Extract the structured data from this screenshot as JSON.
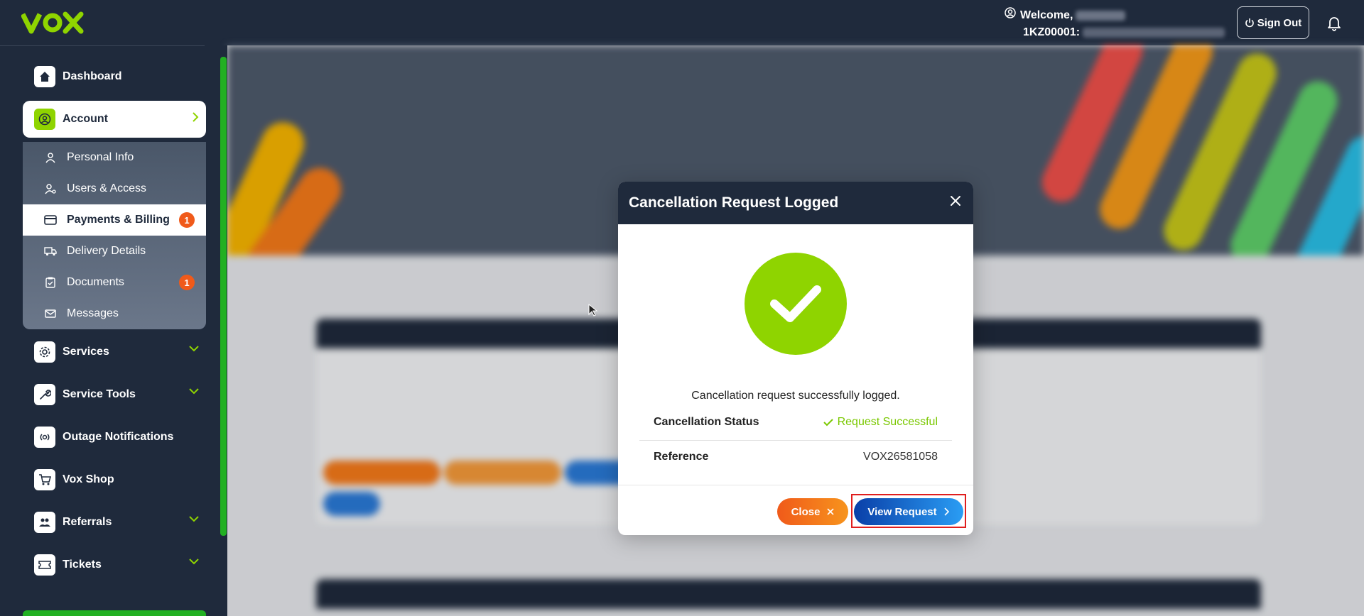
{
  "topbar": {
    "welcome_label": "Welcome,",
    "account_code": "1KZ00001:",
    "signout_label": "Sign Out"
  },
  "sidebar": {
    "items": [
      {
        "label": "Dashboard",
        "icon": "home-icon"
      },
      {
        "label": "Account",
        "icon": "user-circle-icon"
      },
      {
        "label": "Services",
        "icon": "gear-icon"
      },
      {
        "label": "Service Tools",
        "icon": "wrench-icon"
      },
      {
        "label": "Outage Notifications",
        "icon": "signal-icon"
      },
      {
        "label": "Vox Shop",
        "icon": "cart-icon"
      },
      {
        "label": "Referrals",
        "icon": "users-icon"
      },
      {
        "label": "Tickets",
        "icon": "ticket-icon"
      }
    ],
    "account_submenu": [
      {
        "label": "Personal Info",
        "icon": "person-icon"
      },
      {
        "label": "Users & Access",
        "icon": "user-key-icon"
      },
      {
        "label": "Payments & Billing",
        "icon": "card-icon",
        "badge": "1"
      },
      {
        "label": "Delivery Details",
        "icon": "truck-icon"
      },
      {
        "label": "Documents",
        "icon": "clipboard-icon",
        "badge": "1"
      },
      {
        "label": "Messages",
        "icon": "mail-icon"
      }
    ]
  },
  "modal": {
    "title": "Cancellation Request Logged",
    "message": "Cancellation request successfully logged.",
    "status_label": "Cancellation Status",
    "status_value": "Request Successful",
    "reference_label": "Reference",
    "reference_value": "VOX26581058",
    "close_button": "Close",
    "view_button": "View Request"
  },
  "colors": {
    "navy": "#1f2a3c",
    "accent_green": "#8fd400",
    "orange": "#f05a1a",
    "blue": "#0a3fa8"
  }
}
